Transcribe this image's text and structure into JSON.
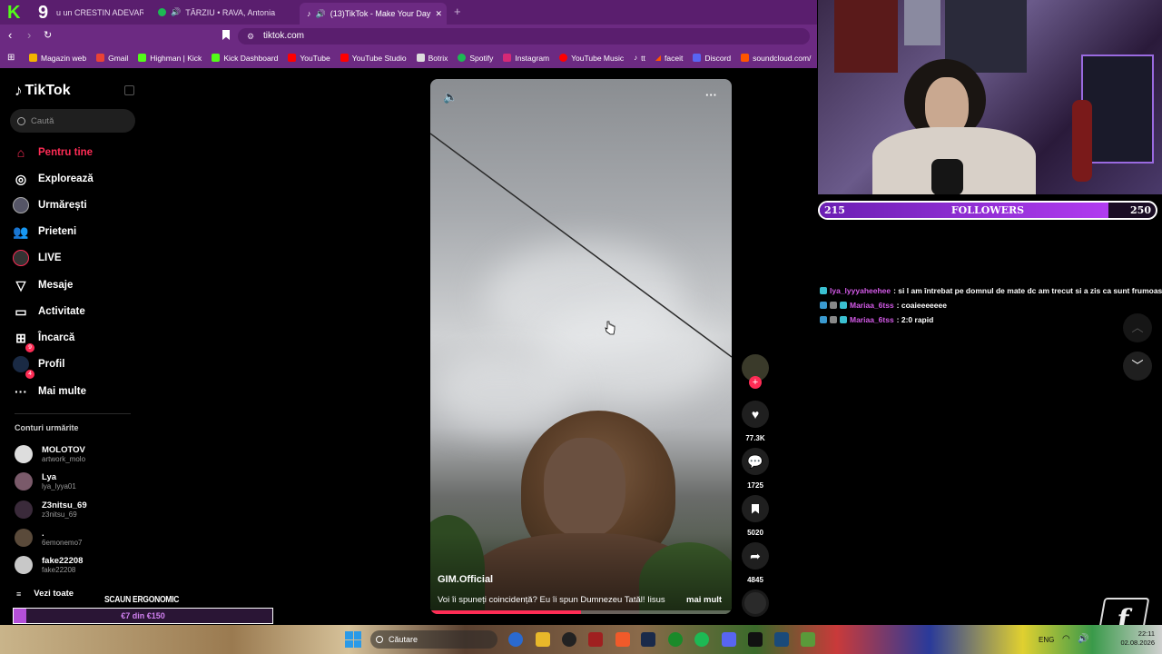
{
  "browser": {
    "tabs": [
      {
        "label": "u un CRESTIN ADEVARAT ca"
      },
      {
        "label": "TÂRZIU • RAVA, Antonia"
      },
      {
        "label": "(13)TikTok - Make Your Day"
      }
    ],
    "url": "tiktok.com",
    "bookmarks": [
      "Magazin web",
      "Gmail",
      "Highman | Kick",
      "Kick Dashboard",
      "YouTube",
      "YouTube Studio",
      "Botrix",
      "Spotify",
      "Instagram",
      "YouTube Music",
      "tt",
      "faceit",
      "Discord",
      "soundcloud.com/"
    ]
  },
  "tiktok": {
    "logo": "TikTok",
    "search_placeholder": "Caută",
    "nav": [
      {
        "label": "Pentru tine",
        "icon": "home-icon",
        "color": "#fe2c55"
      },
      {
        "label": "Explorează",
        "icon": "compass-icon"
      },
      {
        "label": "Urmărești",
        "icon": "following-icon"
      },
      {
        "label": "Prieteni",
        "icon": "friends-icon"
      },
      {
        "label": "LIVE",
        "icon": "live-icon"
      },
      {
        "label": "Mesaje",
        "icon": "messages-icon",
        "badge": "9"
      },
      {
        "label": "Activitate",
        "icon": "activity-icon",
        "badge": "4"
      },
      {
        "label": "Încarcă",
        "icon": "upload-icon"
      },
      {
        "label": "Profil",
        "icon": "profile-icon"
      },
      {
        "label": "Mai multe",
        "icon": "more-icon"
      }
    ],
    "following_title": "Conturi urmărite",
    "accounts": [
      {
        "name": "MOLOTOV",
        "handle": "artwork_molo"
      },
      {
        "name": "Lya",
        "handle": "lya_lyya01"
      },
      {
        "name": "Z3nitsu_69",
        "handle": "z3nitsu_69"
      },
      {
        "name": ".",
        "handle": "6emonemo7"
      },
      {
        "name": "fake22208",
        "handle": "fake22208"
      }
    ],
    "see_all": "Vezi toate",
    "video": {
      "author": "GIM.Official",
      "caption": "Voi îi spuneți coincidență? Eu îi spun Dumnezeu Tatăl! Iisus",
      "more": "mai mult"
    },
    "actions": {
      "likes": "77.3K",
      "comments": "1725",
      "saves": "5020",
      "shares": "4845"
    }
  },
  "stream": {
    "followers_current": "215",
    "followers_label": "FOLLOWERS",
    "followers_goal": "250",
    "followers_fraction": 0.86,
    "chair_label": "SCAUN ERGONOMIC",
    "chair_progress": "€7 din €150",
    "chair_fraction": 0.05,
    "chat": [
      {
        "user": "lya_lyyyaheehee",
        "message": ": si l am întrebat pe domnul de mate dc am trecut si a zis ca sunt frumoasă"
      },
      {
        "user": "Mariaa_6tss",
        "message": ": coaieeeeeee"
      },
      {
        "user": "Mariaa_6tss",
        "message": ": 2:0 rapid"
      }
    ]
  },
  "taskbar": {
    "search": "Căutare",
    "lang": "ENG",
    "time": "22:11",
    "date": "02.08.2026"
  },
  "colors": {
    "accent": "#fe2c55",
    "browser": "#6c2a82",
    "stream": "#b13cf0"
  }
}
